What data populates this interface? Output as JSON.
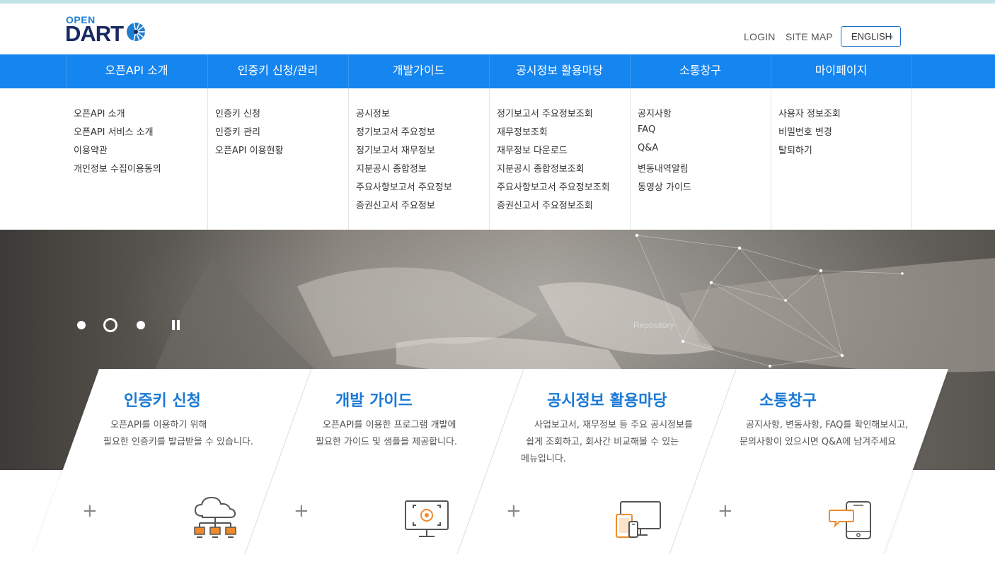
{
  "logo": {
    "top": "OPEN",
    "main": "DART"
  },
  "header": {
    "login": "LOGIN",
    "sitemap": "SITE MAP",
    "english": "ENGLISH",
    "english_chevron": "›"
  },
  "nav": [
    {
      "label": "오픈API 소개",
      "links": [
        "오픈API 소개",
        "오픈API 서비스 소개",
        "이용약관",
        "개인정보 수집이용동의"
      ]
    },
    {
      "label": "인증키 신청/관리",
      "links": [
        "인증키 신청",
        "인증키 관리",
        "오픈API 이용현황"
      ]
    },
    {
      "label": "개발가이드",
      "links": [
        "공시정보",
        "정기보고서 주요정보",
        "정기보고서 재무정보",
        "지분공시 종합정보",
        "주요사항보고서 주요정보",
        "증권신고서 주요정보"
      ]
    },
    {
      "label": "공시정보 활용마당",
      "links": [
        "정기보고서 주요정보조회",
        "재무정보조회",
        "재무정보 다운로드",
        "지분공시 종합정보조회",
        "주요사항보고서 주요정보조회",
        "증권신고서 주요정보조회"
      ]
    },
    {
      "label": "소통창구",
      "links": [
        "공지사항",
        "FAQ",
        "Q&A",
        "변동내역알림",
        "동영상 가이드"
      ]
    },
    {
      "label": "마이페이지",
      "links": [
        "사용자 정보조회",
        "비밀번호 변경",
        "탈퇴하기"
      ]
    }
  ],
  "hero": {
    "repository": "Repository"
  },
  "cards": [
    {
      "title": "인증키 신청",
      "desc": [
        "오픈API를 이용하기 위해",
        "필요한 인증키를 발급받을 수 있습니다."
      ],
      "plus": "+",
      "icon": "cloud-network-icon"
    },
    {
      "title": "개발 가이드",
      "desc": [
        "오픈API를 이용한 프로그램 개발에",
        "필요한 가이드 및 샘플을 제공합니다."
      ],
      "plus": "+",
      "icon": "monitor-target-icon"
    },
    {
      "title": "공시정보 활용마당",
      "desc": [
        "사업보고서, 재무정보 등 주요 공시정보를",
        "쉽게 조회하고, 회사간 비교해볼 수 있는",
        "메뉴입니다."
      ],
      "plus": "+",
      "icon": "multi-device-icon"
    },
    {
      "title": "소통창구",
      "desc": [
        "공지사항, 변동사항, FAQ를 확인해보시고,",
        "문의사항이 있으시면 Q&A에 남겨주세요"
      ],
      "plus": "+",
      "icon": "phone-chat-icon"
    }
  ],
  "colors": {
    "nav_bg": "#1585f0",
    "accent_title": "#1979d6",
    "orange_accent": "#f08a2a",
    "logo_navy": "#172a62"
  }
}
